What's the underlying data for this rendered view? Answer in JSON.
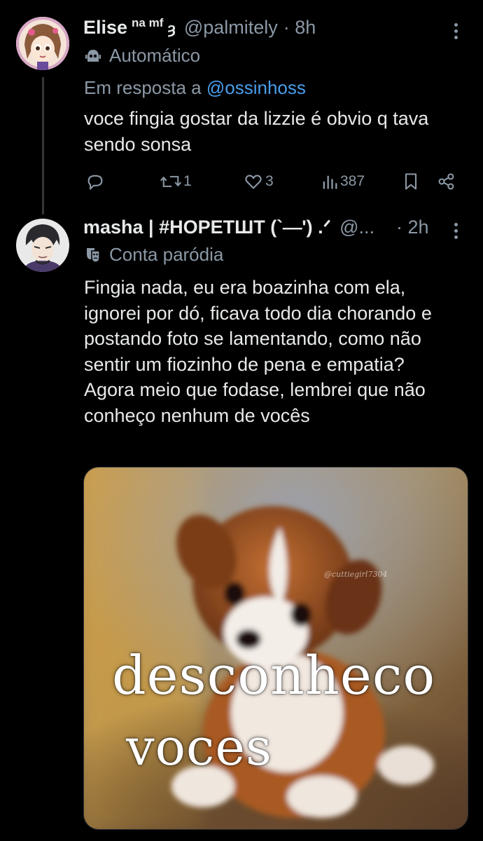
{
  "tweets": [
    {
      "name": "Elise",
      "name_suffix": "na mf",
      "name_emoji": "ȝ",
      "handle": "@palmitely",
      "time": "· 8h",
      "label": "Automático",
      "reply_prefix": "Em resposta a",
      "reply_to": "@ossinhoss",
      "text": "voce fingia gostar da lizzie é obvio q tava sendo sonsa",
      "actions": {
        "replies": "",
        "retweets": "1",
        "likes": "3",
        "views": "387"
      }
    },
    {
      "name": "masha | #HOPETШT (`⎯⎯') .ᐟ",
      "handle": "@...",
      "time": "· 2h",
      "label": "Conta paródia",
      "text": "Fingia nada, eu era boazinha com ela, ignorei por dó, ficava todo dia chorando e postando foto se lamentando, como não sentir um fiozinho de pena e empatia? Agora meio que fodase, lembrei que não conheço nenhum de vocês",
      "image": {
        "caption_line1": "desconheco",
        "caption_line2": "voces",
        "watermark": "@cuttiegirl7304"
      }
    }
  ],
  "colors": {
    "background": "#000000",
    "text": "#e7e9ea",
    "muted": "#8b98a5",
    "link": "#4a9eeb",
    "divider": "#2f3336"
  }
}
